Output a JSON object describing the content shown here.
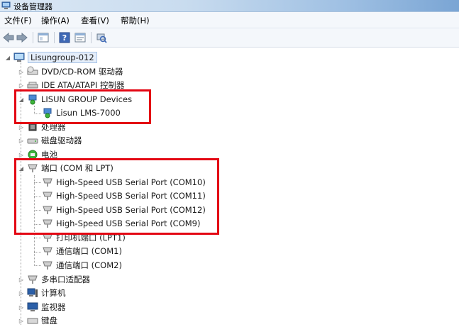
{
  "window": {
    "title": "设备管理器"
  },
  "menu": [
    "文件(F)",
    "操作(A)",
    "查看(V)",
    "帮助(H)"
  ],
  "tree": {
    "root": "Lisungroup-012",
    "items": [
      {
        "label": "DVD/CD-ROM 驱动器",
        "icon": "dvd-drive-icon"
      },
      {
        "label": "IDE ATA/ATAPI 控制器",
        "icon": "ide-controller-icon"
      },
      {
        "label": "LISUN GROUP Devices",
        "icon": "network-device-icon",
        "expanded": true,
        "children": [
          "Lisun LMS-7000"
        ]
      },
      {
        "label": "处理器",
        "icon": "processor-icon"
      },
      {
        "label": "磁盘驱动器",
        "icon": "disk-drive-icon"
      },
      {
        "label": "电池",
        "icon": "battery-icon"
      },
      {
        "label": "端口 (COM 和 LPT)",
        "icon": "port-icon",
        "expanded": true,
        "children": [
          "High-Speed USB Serial Port (COM10)",
          "High-Speed USB Serial Port (COM11)",
          "High-Speed USB Serial Port (COM12)",
          "High-Speed USB Serial Port (COM9)",
          "打印机端口 (LPT1)",
          "通信端口 (COM1)",
          "通信端口 (COM2)"
        ]
      },
      {
        "label": "多串口适配器",
        "icon": "serial-adapter-icon"
      },
      {
        "label": "计算机",
        "icon": "computer-icon"
      },
      {
        "label": "监视器",
        "icon": "monitor-icon"
      },
      {
        "label": "键盘",
        "icon": "keyboard-icon"
      }
    ]
  },
  "highlight_color": "#e30613"
}
